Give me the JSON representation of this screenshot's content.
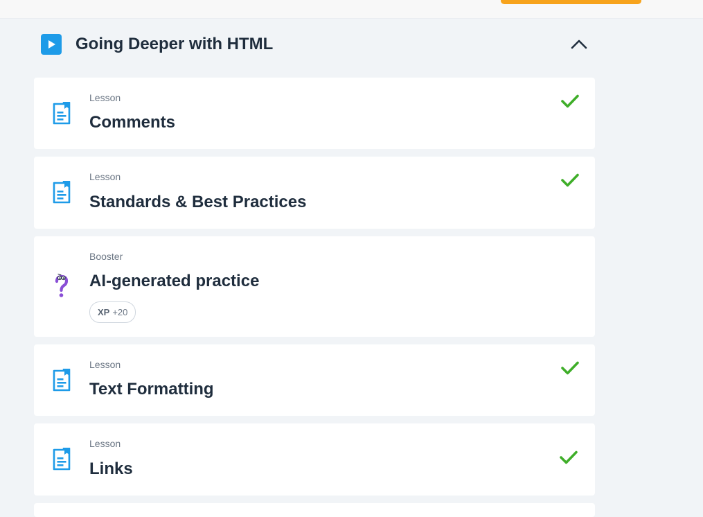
{
  "section": {
    "title": "Going Deeper with HTML",
    "icon": "play-icon",
    "collapse_icon": "chevron-up-icon"
  },
  "items": [
    {
      "kind": "Lesson",
      "title": "Comments",
      "icon": "lesson-document-icon",
      "completed": true
    },
    {
      "kind": "Lesson",
      "title": "Standards & Best Practices",
      "icon": "lesson-document-icon",
      "completed": true
    },
    {
      "kind": "Booster",
      "title": "AI-generated practice",
      "icon": "question-mark-icon",
      "completed": false,
      "xp_label": "XP",
      "xp_value": "+20"
    },
    {
      "kind": "Lesson",
      "title": "Text Formatting",
      "icon": "lesson-document-icon",
      "completed": true
    },
    {
      "kind": "Lesson",
      "title": "Links",
      "icon": "lesson-document-icon",
      "completed": true
    }
  ],
  "colors": {
    "accent_blue": "#1e9be8",
    "check_green": "#3fae29",
    "top_accent_orange": "#f7a31c",
    "booster_purple": "#8a4fd6"
  }
}
